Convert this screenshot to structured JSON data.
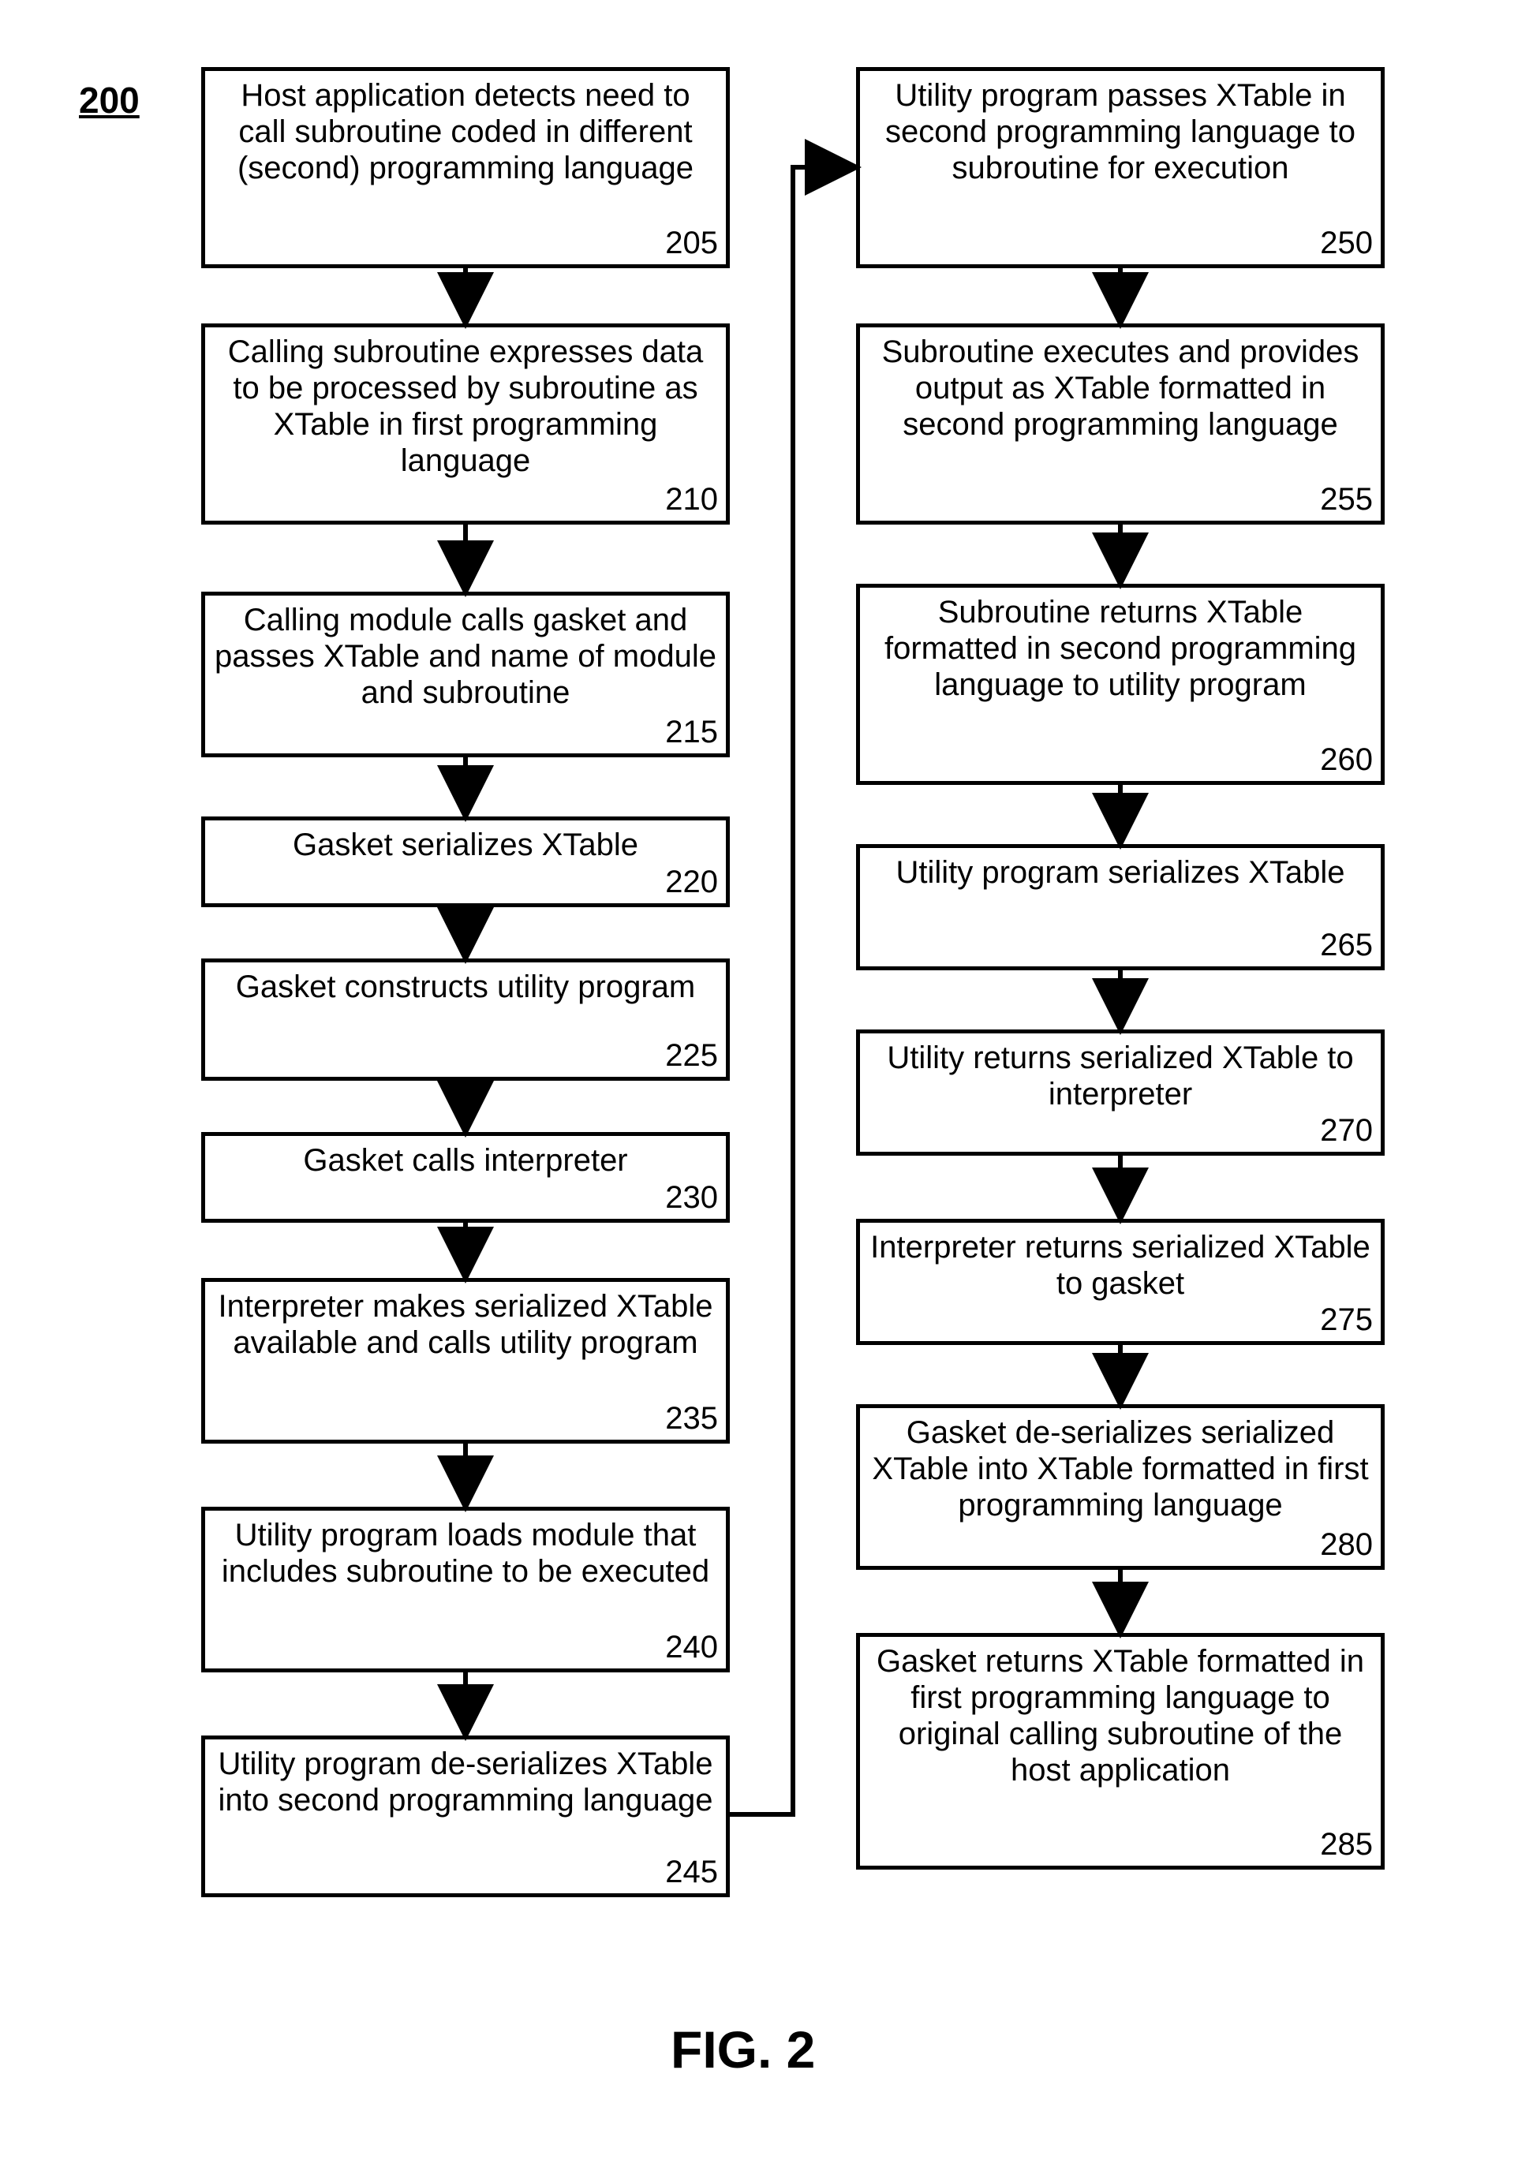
{
  "figure_label": "200",
  "caption": "FIG. 2",
  "boxes": {
    "b205": {
      "text": "Host application detects need to call subroutine coded in different (second) programming language",
      "ref": "205"
    },
    "b210": {
      "text": "Calling subroutine expresses data to be processed by subroutine as XTable in first programming language",
      "ref": "210"
    },
    "b215": {
      "text": "Calling module calls gasket and passes XTable and name of module and subroutine",
      "ref": "215"
    },
    "b220": {
      "text": "Gasket serializes XTable",
      "ref": "220"
    },
    "b225": {
      "text": "Gasket constructs utility program",
      "ref": "225"
    },
    "b230": {
      "text": "Gasket calls interpreter",
      "ref": "230"
    },
    "b235": {
      "text": "Interpreter makes serialized XTable available and calls utility program",
      "ref": "235"
    },
    "b240": {
      "text": "Utility program loads module that includes subroutine to be executed",
      "ref": "240"
    },
    "b245": {
      "text": "Utility program de-serializes XTable into second programming language",
      "ref": "245"
    },
    "b250": {
      "text": "Utility program passes XTable in second programming language to subroutine for execution",
      "ref": "250"
    },
    "b255": {
      "text": "Subroutine executes and provides output as XTable formatted in second programming language",
      "ref": "255"
    },
    "b260": {
      "text": "Subroutine returns XTable formatted in second programming language to utility program",
      "ref": "260"
    },
    "b265": {
      "text": "Utility program serializes XTable",
      "ref": "265"
    },
    "b270": {
      "text": "Utility returns serialized XTable to interpreter",
      "ref": "270"
    },
    "b275": {
      "text": "Interpreter returns serialized XTable to gasket",
      "ref": "275"
    },
    "b280": {
      "text": "Gasket de-serializes serialized XTable into XTable formatted in first programming language",
      "ref": "280"
    },
    "b285": {
      "text": "Gasket returns XTable formatted in first programming language to original calling subroutine of the host application",
      "ref": "285"
    }
  }
}
